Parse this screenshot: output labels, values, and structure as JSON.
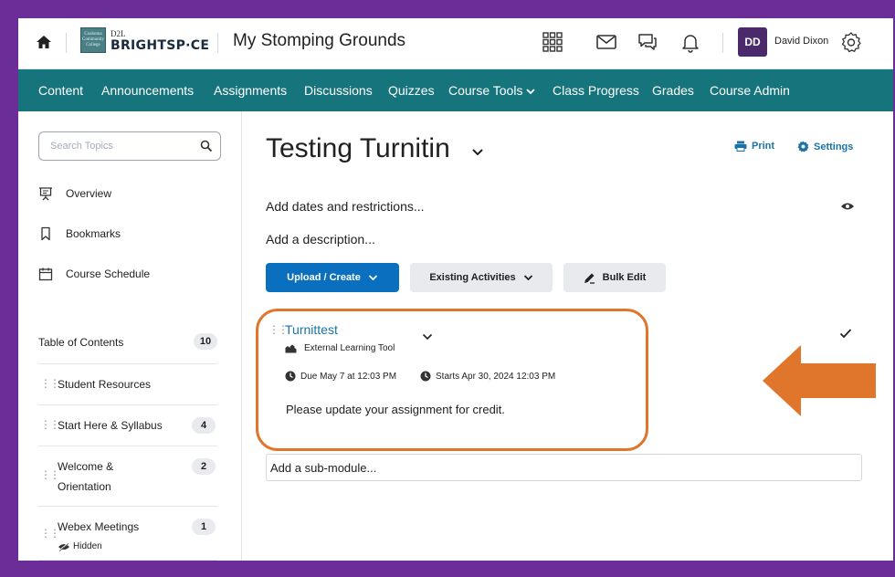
{
  "header": {
    "logo": {
      "small": "D2L",
      "big": "BRIGHTSP·CE",
      "seal_text": "Coahoma Community College"
    },
    "course_title": "My Stomping Grounds",
    "user": {
      "initials": "DD",
      "name": "David Dixon"
    }
  },
  "nav": {
    "items": [
      {
        "label": "Content"
      },
      {
        "label": "Announcements"
      },
      {
        "label": "Assignments"
      },
      {
        "label": "Discussions"
      },
      {
        "label": "Quizzes"
      },
      {
        "label": "Course Tools",
        "dropdown": true
      },
      {
        "label": "Class Progress"
      },
      {
        "label": "Grades"
      },
      {
        "label": "Course Admin"
      }
    ]
  },
  "sidebar": {
    "search_placeholder": "Search Topics",
    "links": [
      {
        "label": "Overview",
        "icon": "presentation-icon"
      },
      {
        "label": "Bookmarks",
        "icon": "bookmark-icon"
      },
      {
        "label": "Course Schedule",
        "icon": "calendar-icon"
      }
    ],
    "toc": {
      "label": "Table of Contents",
      "count": "10"
    },
    "modules": [
      {
        "label": "Student Resources",
        "count": ""
      },
      {
        "label": "Start Here & Syllabus",
        "count": "4"
      },
      {
        "label_line1": "Welcome &",
        "label_line2": "Orientation",
        "count": "2"
      },
      {
        "label": "Webex Meetings",
        "count": "1",
        "status": "Hidden"
      }
    ]
  },
  "main": {
    "title": "Testing Turnitin",
    "print_label": "Print",
    "settings_label": "Settings",
    "add_dates": "Add dates and restrictions...",
    "add_description": "Add a description...",
    "buttons": {
      "upload": "Upload / Create",
      "existing": "Existing Activities",
      "bulk": "Bulk Edit"
    },
    "activity": {
      "title": "Turnittest",
      "type": "External Learning Tool",
      "due": "Due May 7 at 12:03 PM",
      "starts": "Starts Apr 30, 2024 12:03 PM",
      "description": "Please update your assignment for credit."
    },
    "submodule_placeholder": "Add a sub-module..."
  },
  "colors": {
    "nav_bg": "#16757c",
    "frame": "#6b2e98",
    "accent_link": "#1a73a8",
    "primary_button": "#0a6fbf",
    "highlight_orange": "#e0762b",
    "avatar": "#4a2a6b"
  }
}
